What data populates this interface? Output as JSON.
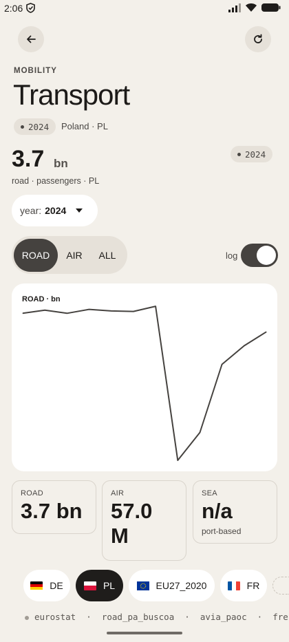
{
  "status_bar": {
    "time": "2:06"
  },
  "header": {
    "section": "MOBILITY",
    "title": "Transport",
    "year_pill": "2024",
    "location": "Poland · PL"
  },
  "headline": {
    "value": "3.7",
    "unit": "bn",
    "subtitle": "road · passengers · PL",
    "year_badge": "2024"
  },
  "year_select": {
    "label": "year:",
    "value": "2024"
  },
  "mode_tabs": [
    {
      "label": "ROAD",
      "active": true
    },
    {
      "label": "AIR",
      "active": false
    },
    {
      "label": "ALL",
      "active": false
    }
  ],
  "scale_toggle": {
    "label": "log",
    "on": true
  },
  "chart_data": {
    "type": "line",
    "title": "ROAD · bn",
    "series": [
      {
        "values": [
          0.95,
          0.97,
          0.95,
          0.975,
          0.965,
          0.962,
          0.995,
          0.0,
          0.18,
          0.62,
          0.74,
          0.83
        ]
      }
    ],
    "grid": false
  },
  "stats": [
    {
      "label": "ROAD",
      "value": "3.7 bn",
      "note": ""
    },
    {
      "label": "AIR",
      "value": "57.0 M",
      "note": ""
    },
    {
      "label": "SEA",
      "value": "n/a",
      "note": "port-based"
    }
  ],
  "countries": [
    {
      "code": "DE",
      "active": false
    },
    {
      "code": "PL",
      "active": true
    },
    {
      "code": "EU27_2020",
      "active": false
    },
    {
      "code": "FR",
      "active": false
    }
  ],
  "footer": {
    "source": "eurostat",
    "dataset": "road_pa_buscoa",
    "dataset2": "avia_paoc",
    "freshness": "fresh"
  }
}
